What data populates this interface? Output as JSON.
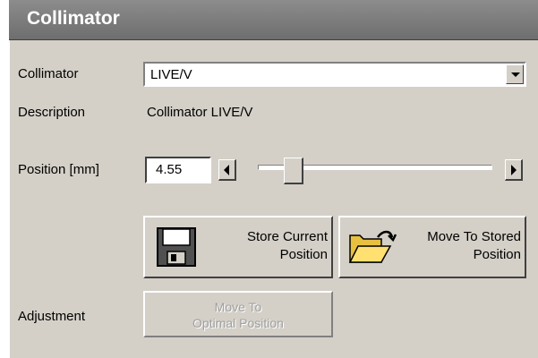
{
  "window": {
    "title": "Collimator"
  },
  "fields": {
    "collimator_label": "Collimator",
    "collimator_value": "LIVE/V",
    "description_label": "Description",
    "description_value": "Collimator LIVE/V",
    "position_label": "Position [mm]",
    "position_value": "4.55",
    "position_slider_fraction": 0.12,
    "adjustment_label": "Adjustment"
  },
  "buttons": {
    "store_line1": "Store Current",
    "store_line2": "Position",
    "move_stored_line1": "Move To Stored",
    "move_stored_line2": "Position",
    "move_optimal_line1": "Move To",
    "move_optimal_line2": "Optimal Position",
    "move_optimal_enabled": false
  },
  "icons": {
    "store": "floppy-disk-icon",
    "move_stored": "open-folder-icon",
    "dropdown": "chevron-down-icon",
    "decrement": "arrow-left-icon",
    "increment": "arrow-right-icon"
  },
  "colors": {
    "title_bar": "#7a7a7a",
    "panel": "#d4d0c8",
    "disabled_text": "#a0a0a0"
  }
}
